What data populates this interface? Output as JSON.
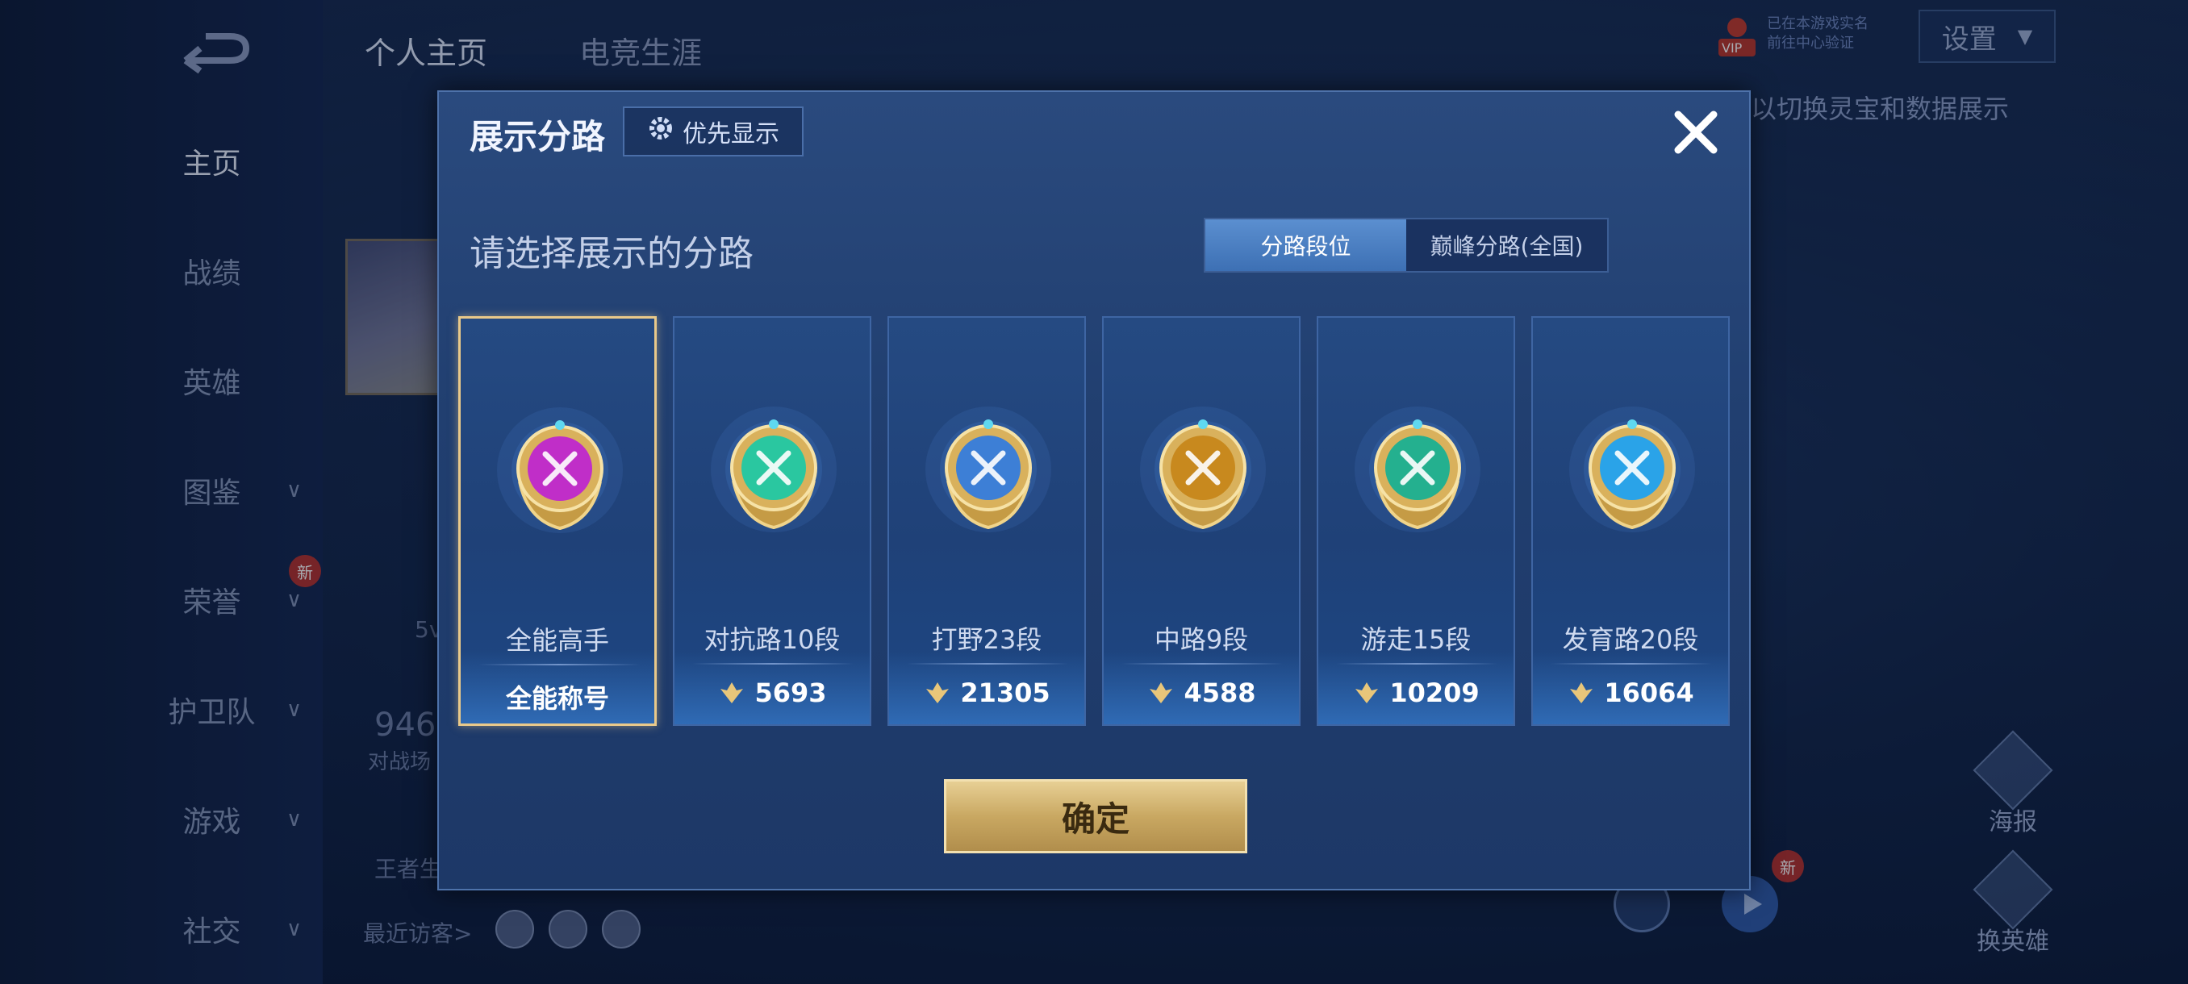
{
  "sidebar": {
    "items": [
      {
        "label": "主页",
        "active": true,
        "chevron": false
      },
      {
        "label": "战绩",
        "chevron": false
      },
      {
        "label": "英雄",
        "chevron": false
      },
      {
        "label": "图鉴",
        "chevron": true
      },
      {
        "label": "荣誉",
        "chevron": true,
        "badge": "新"
      },
      {
        "label": "护卫队",
        "chevron": true
      },
      {
        "label": "游戏",
        "chevron": true
      },
      {
        "label": "社交",
        "chevron": true
      }
    ]
  },
  "header": {
    "tabs": [
      {
        "label": "个人主页",
        "active": true
      },
      {
        "label": "电竞生涯"
      }
    ],
    "settings_label": "设置",
    "vip_label": "VIP",
    "vip_line1": "已在本游戏实名",
    "vip_line2": "前往中心验证",
    "hint": "以切换灵宝和数据展示"
  },
  "background": {
    "stat_value": "946",
    "stat_label": "对战场",
    "partial_5v": "5v",
    "partial_wz": "王者生",
    "recent_visitors_label": "最近访客>",
    "side_buttons": [
      {
        "label": "海报"
      },
      {
        "label": "换英雄"
      }
    ],
    "new_badge_2": "新"
  },
  "dialog": {
    "title": "展示分路",
    "priority_button": "优先显示",
    "section_title": "请选择展示的分路",
    "segments": [
      {
        "label": "分路段位",
        "active": true
      },
      {
        "label": "巅峰分路(全国)"
      }
    ],
    "cards": [
      {
        "name": "全能高手",
        "value": "全能称号",
        "selected": true,
        "emblem": "purple-all-round",
        "color": "#c02ec8",
        "show_icon": false
      },
      {
        "name": "对抗路10段",
        "value": "5693",
        "emblem": "teal-clash-lane",
        "color": "#2ac7a0",
        "show_icon": true
      },
      {
        "name": "打野23段",
        "value": "21305",
        "emblem": "blue-dragon-jungle",
        "color": "#3d7fd6",
        "show_icon": true
      },
      {
        "name": "中路9段",
        "value": "4588",
        "emblem": "gold-mid-lane",
        "color": "#c8891e",
        "show_icon": true
      },
      {
        "name": "游走15段",
        "value": "10209",
        "emblem": "teal-wings-roam",
        "color": "#24b08f",
        "show_icon": true
      },
      {
        "name": "发育路20段",
        "value": "16064",
        "emblem": "blue-farm-lane",
        "color": "#2aa3e8",
        "show_icon": true
      }
    ],
    "confirm_label": "确定"
  },
  "colors": {
    "accent_gold": "#e9c98a",
    "dialog_bg": "#213f70",
    "segment_active": "#4a7fc4"
  }
}
